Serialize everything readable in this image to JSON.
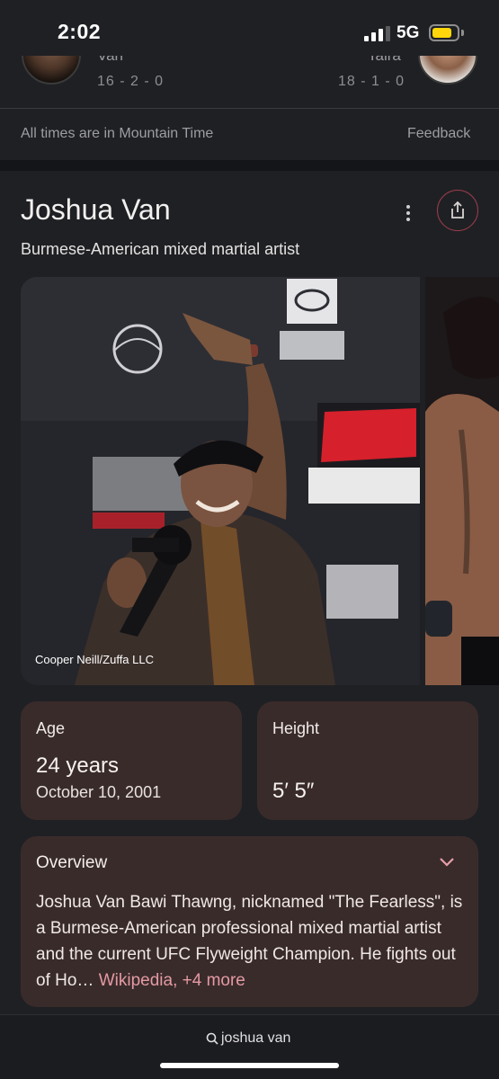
{
  "status": {
    "time": "2:02",
    "network": "5G",
    "colors": {
      "battery": "#ffd60a"
    }
  },
  "fight": {
    "left": {
      "name": "Van",
      "record": "16 - 2 - 0"
    },
    "right": {
      "name": "Taira",
      "record": "18 - 1 - 0"
    }
  },
  "footer_note": {
    "timezone": "All times are in Mountain Time",
    "feedback": "Feedback"
  },
  "knowledge_panel": {
    "title": "Joshua Van",
    "subtitle": "Burmese-American mixed martial artist",
    "icons": {
      "more": "more-vert-icon",
      "share": "share-icon"
    },
    "photo_credit": "Cooper Neill/Zuffa LLC",
    "age": {
      "label": "Age",
      "value": "24 years",
      "date": "October 10, 2001"
    },
    "height": {
      "label": "Height",
      "value": "5′ 5″"
    },
    "overview": {
      "label": "Overview",
      "text": "Joshua Van Bawi Thawng, nicknamed \"The Fearless\", is a Burmese-American professional mixed martial artist and the current UFC Flyweight Champion. He fights out of Ho…",
      "link": "Wikipedia, +4 more"
    }
  },
  "search": {
    "query": "joshua van",
    "icon": "search-icon"
  },
  "colors": {
    "background": "#1f2024",
    "card": "#3a2b2b",
    "accent_link": "#e39aa3"
  }
}
